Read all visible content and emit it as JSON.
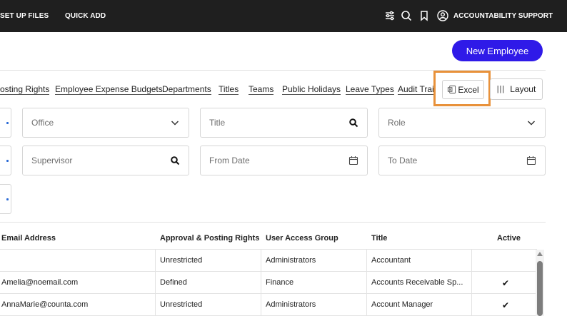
{
  "topnav": {
    "setup_files": "SET UP FILES",
    "quick_add": "QUICK ADD",
    "user_label": "ACCOUNTABILITY SUPPORT",
    "icons": [
      "sliders-icon",
      "search-icon",
      "bookmark-icon",
      "user-circle-icon"
    ]
  },
  "actions": {
    "new_employee": "New Employee",
    "excel": "Excel",
    "layout": "Layout"
  },
  "tabs": [
    "osting Rights",
    "Employee Expense Budgets",
    "Departments",
    "Titles",
    "Teams",
    "Public Holidays",
    "Leave Types",
    "Audit Trail"
  ],
  "filters": {
    "office": "Office",
    "title": "Title",
    "role": "Role",
    "supervisor": "Supervisor",
    "from_date": "From Date",
    "to_date": "To Date"
  },
  "table": {
    "columns": [
      "Email Address",
      "Approval & Posting Rights",
      "User Access Group",
      "Title",
      "Active"
    ],
    "rows": [
      {
        "email": "",
        "rights": "Unrestricted",
        "group": "Administrators",
        "title": "Accountant",
        "active": ""
      },
      {
        "email": "Amelia@noemail.com",
        "rights": "Defined",
        "group": "Finance",
        "title": "Accounts Receivable Sp...",
        "active": "✔"
      },
      {
        "email": "AnnaMarie@counta.com",
        "rights": "Unrestricted",
        "group": "Administrators",
        "title": "Account Manager",
        "active": "✔"
      }
    ]
  },
  "colors": {
    "topbar": "#1f1f1f",
    "primary_button": "#2f1ae8",
    "highlight": "#e8913a"
  }
}
